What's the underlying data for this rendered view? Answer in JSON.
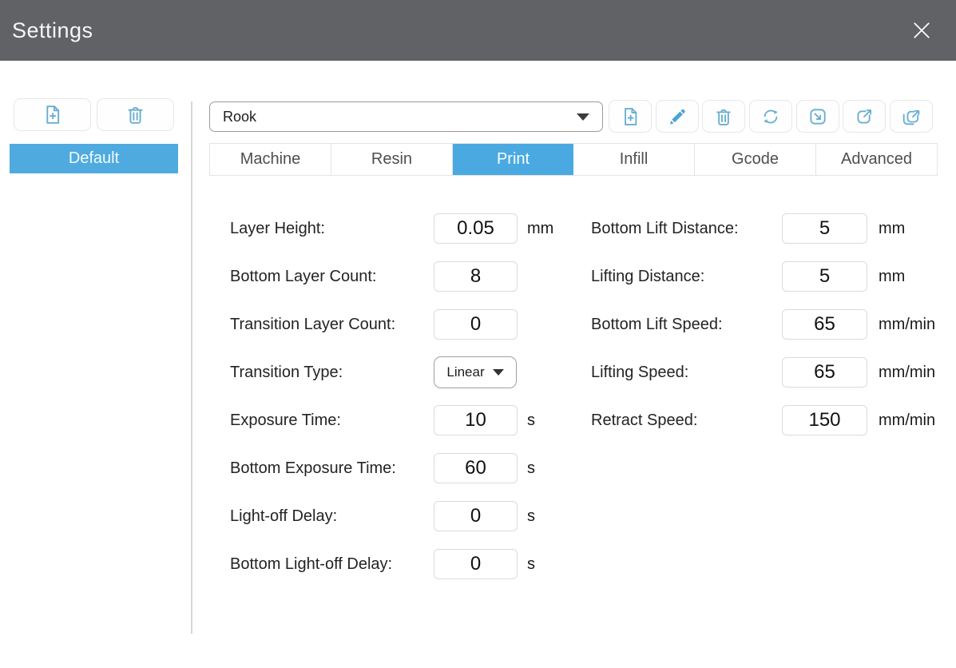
{
  "window": {
    "title": "Settings"
  },
  "colors": {
    "header_bg": "#616265",
    "accent_blue": "#4aa9e1",
    "selected_item_blue": "#4fabdf",
    "icon_blue": "#68aecf"
  },
  "sidebar": {
    "add_button_icon": "file-plus-icon",
    "delete_button_icon": "trash-icon",
    "items": [
      {
        "label": "Default",
        "selected": true
      }
    ]
  },
  "preset_bar": {
    "selected_profile": "Rook",
    "toolbar_icons": [
      "file-plus",
      "pencil",
      "trash",
      "refresh",
      "import",
      "export",
      "export-all"
    ]
  },
  "tabs": {
    "items": [
      {
        "label": "Machine",
        "active": false
      },
      {
        "label": "Resin",
        "active": false
      },
      {
        "label": "Print",
        "active": true
      },
      {
        "label": "Infill",
        "active": false
      },
      {
        "label": "Gcode",
        "active": false
      },
      {
        "label": "Advanced",
        "active": false
      }
    ]
  },
  "form": {
    "left": [
      {
        "label": "Layer Height:",
        "value": "0.05",
        "unit": "mm",
        "type": "input"
      },
      {
        "label": "Bottom Layer Count:",
        "value": "8",
        "unit": "",
        "type": "input"
      },
      {
        "label": "Transition Layer Count:",
        "value": "0",
        "unit": "",
        "type": "input"
      },
      {
        "label": "Transition Type:",
        "value": "Linear",
        "unit": "",
        "type": "select"
      },
      {
        "label": "Exposure Time:",
        "value": "10",
        "unit": "s",
        "type": "input"
      },
      {
        "label": "Bottom Exposure Time:",
        "value": "60",
        "unit": "s",
        "type": "input"
      },
      {
        "label": "Light-off Delay:",
        "value": "0",
        "unit": "s",
        "type": "input"
      },
      {
        "label": "Bottom Light-off Delay:",
        "value": "0",
        "unit": "s",
        "type": "input"
      }
    ],
    "right": [
      {
        "label": "Bottom Lift Distance:",
        "value": "5",
        "unit": "mm",
        "type": "input"
      },
      {
        "label": "Lifting Distance:",
        "value": "5",
        "unit": "mm",
        "type": "input"
      },
      {
        "label": "Bottom Lift Speed:",
        "value": "65",
        "unit": "mm/min",
        "type": "input"
      },
      {
        "label": "Lifting Speed:",
        "value": "65",
        "unit": "mm/min",
        "type": "input"
      },
      {
        "label": "Retract Speed:",
        "value": "150",
        "unit": "mm/min",
        "type": "input"
      }
    ]
  }
}
